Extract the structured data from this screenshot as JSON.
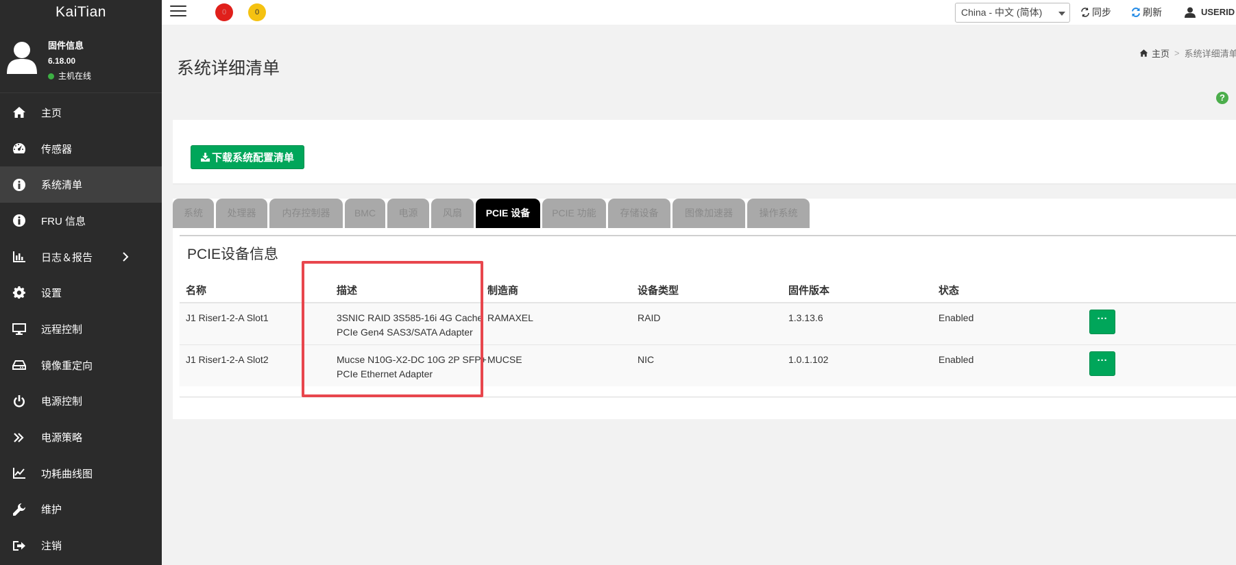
{
  "sidebar": {
    "brand": "KaiTian",
    "user": {
      "firmware_title": "固件信息",
      "firmware_version": "6.18.00",
      "status": "主机在线",
      "status_color": "#3cb043"
    },
    "items": [
      {
        "label": "主页",
        "icon": "home-icon"
      },
      {
        "label": "传感器",
        "icon": "dashboard-icon"
      },
      {
        "label": "系统清单",
        "icon": "info-icon",
        "active": true
      },
      {
        "label": "FRU 信息",
        "icon": "info-icon"
      },
      {
        "label": "日志＆报告",
        "icon": "bar-chart-icon",
        "has_submenu": true
      },
      {
        "label": "设置",
        "icon": "gear-icon"
      },
      {
        "label": "远程控制",
        "icon": "monitor-icon"
      },
      {
        "label": "镜像重定向",
        "icon": "hdd-icon"
      },
      {
        "label": "电源控制",
        "icon": "power-icon"
      },
      {
        "label": "电源策略",
        "icon": "double-chevron-icon"
      },
      {
        "label": "功耗曲线图",
        "icon": "line-chart-icon"
      },
      {
        "label": "维护",
        "icon": "wrench-icon"
      },
      {
        "label": "注销",
        "icon": "sign-out-icon"
      }
    ]
  },
  "topbar": {
    "badge_red": "0",
    "badge_yellow": "0",
    "language": "China - 中文 (简体)",
    "sync_label": "同步",
    "refresh_label": "刷新",
    "user_label": "USERID",
    "accent_colors": {
      "red": "#e0201b",
      "yellow": "#f5c211",
      "refresh": "#1e88e5"
    }
  },
  "page": {
    "title": "系统详细清单",
    "breadcrumb": {
      "home": "主页",
      "sep": ">",
      "current": "系统详细清单"
    },
    "help": "?",
    "download_label": "下载系统配置清单"
  },
  "tabs": [
    {
      "label": "系统"
    },
    {
      "label": "处理器"
    },
    {
      "label": "内存控制器"
    },
    {
      "label": "BMC"
    },
    {
      "label": "电源"
    },
    {
      "label": "风扇"
    },
    {
      "label": "PCIE 设备",
      "active": true
    },
    {
      "label": "PCIE 功能"
    },
    {
      "label": "存储设备"
    },
    {
      "label": "图像加速器"
    },
    {
      "label": "操作系统"
    }
  ],
  "pcie": {
    "title": "PCIE设备信息",
    "columns": [
      "名称",
      "描述",
      "制造商",
      "设备类型",
      "固件版本",
      "状态"
    ],
    "rows": [
      {
        "name": "J1 Riser1-2-A Slot1",
        "desc_line1": "3SNIC RAID 3S585-16i 4G Cache",
        "desc_line2": "PCIe Gen4 SAS3/SATA Adapter",
        "vendor": "RAMAXEL",
        "type": "RAID",
        "firmware": "1.3.13.6",
        "status": "Enabled",
        "action": "···"
      },
      {
        "name": "J1 Riser1-2-A Slot2",
        "desc_line1": "Mucse N10G-X2-DC 10G 2P SFP+",
        "desc_line2": "PCIe Ethernet Adapter",
        "vendor": "MUCSE",
        "type": "NIC",
        "firmware": "1.0.1.102",
        "status": "Enabled",
        "action": "···"
      }
    ]
  },
  "colors": {
    "sidebar_bg": "#2b2b2b",
    "primary_green": "#00a65a",
    "highlight": "#e8464d"
  }
}
